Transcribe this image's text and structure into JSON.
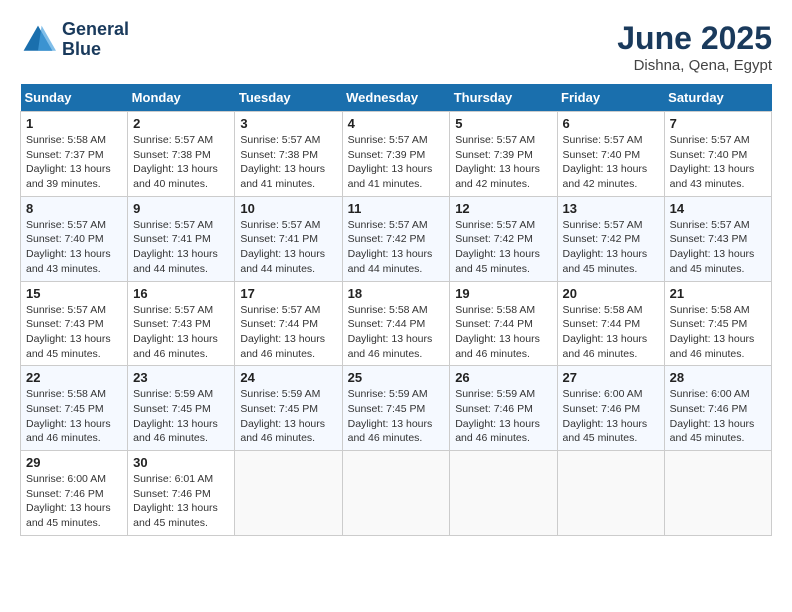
{
  "header": {
    "logo_line1": "General",
    "logo_line2": "Blue",
    "title": "June 2025",
    "subtitle": "Dishna, Qena, Egypt"
  },
  "weekdays": [
    "Sunday",
    "Monday",
    "Tuesday",
    "Wednesday",
    "Thursday",
    "Friday",
    "Saturday"
  ],
  "weeks": [
    [
      {
        "day": "1",
        "sunrise": "5:58 AM",
        "sunset": "7:37 PM",
        "daylight": "13 hours and 39 minutes."
      },
      {
        "day": "2",
        "sunrise": "5:57 AM",
        "sunset": "7:38 PM",
        "daylight": "13 hours and 40 minutes."
      },
      {
        "day": "3",
        "sunrise": "5:57 AM",
        "sunset": "7:38 PM",
        "daylight": "13 hours and 41 minutes."
      },
      {
        "day": "4",
        "sunrise": "5:57 AM",
        "sunset": "7:39 PM",
        "daylight": "13 hours and 41 minutes."
      },
      {
        "day": "5",
        "sunrise": "5:57 AM",
        "sunset": "7:39 PM",
        "daylight": "13 hours and 42 minutes."
      },
      {
        "day": "6",
        "sunrise": "5:57 AM",
        "sunset": "7:40 PM",
        "daylight": "13 hours and 42 minutes."
      },
      {
        "day": "7",
        "sunrise": "5:57 AM",
        "sunset": "7:40 PM",
        "daylight": "13 hours and 43 minutes."
      }
    ],
    [
      {
        "day": "8",
        "sunrise": "5:57 AM",
        "sunset": "7:40 PM",
        "daylight": "13 hours and 43 minutes."
      },
      {
        "day": "9",
        "sunrise": "5:57 AM",
        "sunset": "7:41 PM",
        "daylight": "13 hours and 44 minutes."
      },
      {
        "day": "10",
        "sunrise": "5:57 AM",
        "sunset": "7:41 PM",
        "daylight": "13 hours and 44 minutes."
      },
      {
        "day": "11",
        "sunrise": "5:57 AM",
        "sunset": "7:42 PM",
        "daylight": "13 hours and 44 minutes."
      },
      {
        "day": "12",
        "sunrise": "5:57 AM",
        "sunset": "7:42 PM",
        "daylight": "13 hours and 45 minutes."
      },
      {
        "day": "13",
        "sunrise": "5:57 AM",
        "sunset": "7:42 PM",
        "daylight": "13 hours and 45 minutes."
      },
      {
        "day": "14",
        "sunrise": "5:57 AM",
        "sunset": "7:43 PM",
        "daylight": "13 hours and 45 minutes."
      }
    ],
    [
      {
        "day": "15",
        "sunrise": "5:57 AM",
        "sunset": "7:43 PM",
        "daylight": "13 hours and 45 minutes."
      },
      {
        "day": "16",
        "sunrise": "5:57 AM",
        "sunset": "7:43 PM",
        "daylight": "13 hours and 46 minutes."
      },
      {
        "day": "17",
        "sunrise": "5:57 AM",
        "sunset": "7:44 PM",
        "daylight": "13 hours and 46 minutes."
      },
      {
        "day": "18",
        "sunrise": "5:58 AM",
        "sunset": "7:44 PM",
        "daylight": "13 hours and 46 minutes."
      },
      {
        "day": "19",
        "sunrise": "5:58 AM",
        "sunset": "7:44 PM",
        "daylight": "13 hours and 46 minutes."
      },
      {
        "day": "20",
        "sunrise": "5:58 AM",
        "sunset": "7:44 PM",
        "daylight": "13 hours and 46 minutes."
      },
      {
        "day": "21",
        "sunrise": "5:58 AM",
        "sunset": "7:45 PM",
        "daylight": "13 hours and 46 minutes."
      }
    ],
    [
      {
        "day": "22",
        "sunrise": "5:58 AM",
        "sunset": "7:45 PM",
        "daylight": "13 hours and 46 minutes."
      },
      {
        "day": "23",
        "sunrise": "5:59 AM",
        "sunset": "7:45 PM",
        "daylight": "13 hours and 46 minutes."
      },
      {
        "day": "24",
        "sunrise": "5:59 AM",
        "sunset": "7:45 PM",
        "daylight": "13 hours and 46 minutes."
      },
      {
        "day": "25",
        "sunrise": "5:59 AM",
        "sunset": "7:45 PM",
        "daylight": "13 hours and 46 minutes."
      },
      {
        "day": "26",
        "sunrise": "5:59 AM",
        "sunset": "7:46 PM",
        "daylight": "13 hours and 46 minutes."
      },
      {
        "day": "27",
        "sunrise": "6:00 AM",
        "sunset": "7:46 PM",
        "daylight": "13 hours and 45 minutes."
      },
      {
        "day": "28",
        "sunrise": "6:00 AM",
        "sunset": "7:46 PM",
        "daylight": "13 hours and 45 minutes."
      }
    ],
    [
      {
        "day": "29",
        "sunrise": "6:00 AM",
        "sunset": "7:46 PM",
        "daylight": "13 hours and 45 minutes."
      },
      {
        "day": "30",
        "sunrise": "6:01 AM",
        "sunset": "7:46 PM",
        "daylight": "13 hours and 45 minutes."
      },
      null,
      null,
      null,
      null,
      null
    ]
  ]
}
